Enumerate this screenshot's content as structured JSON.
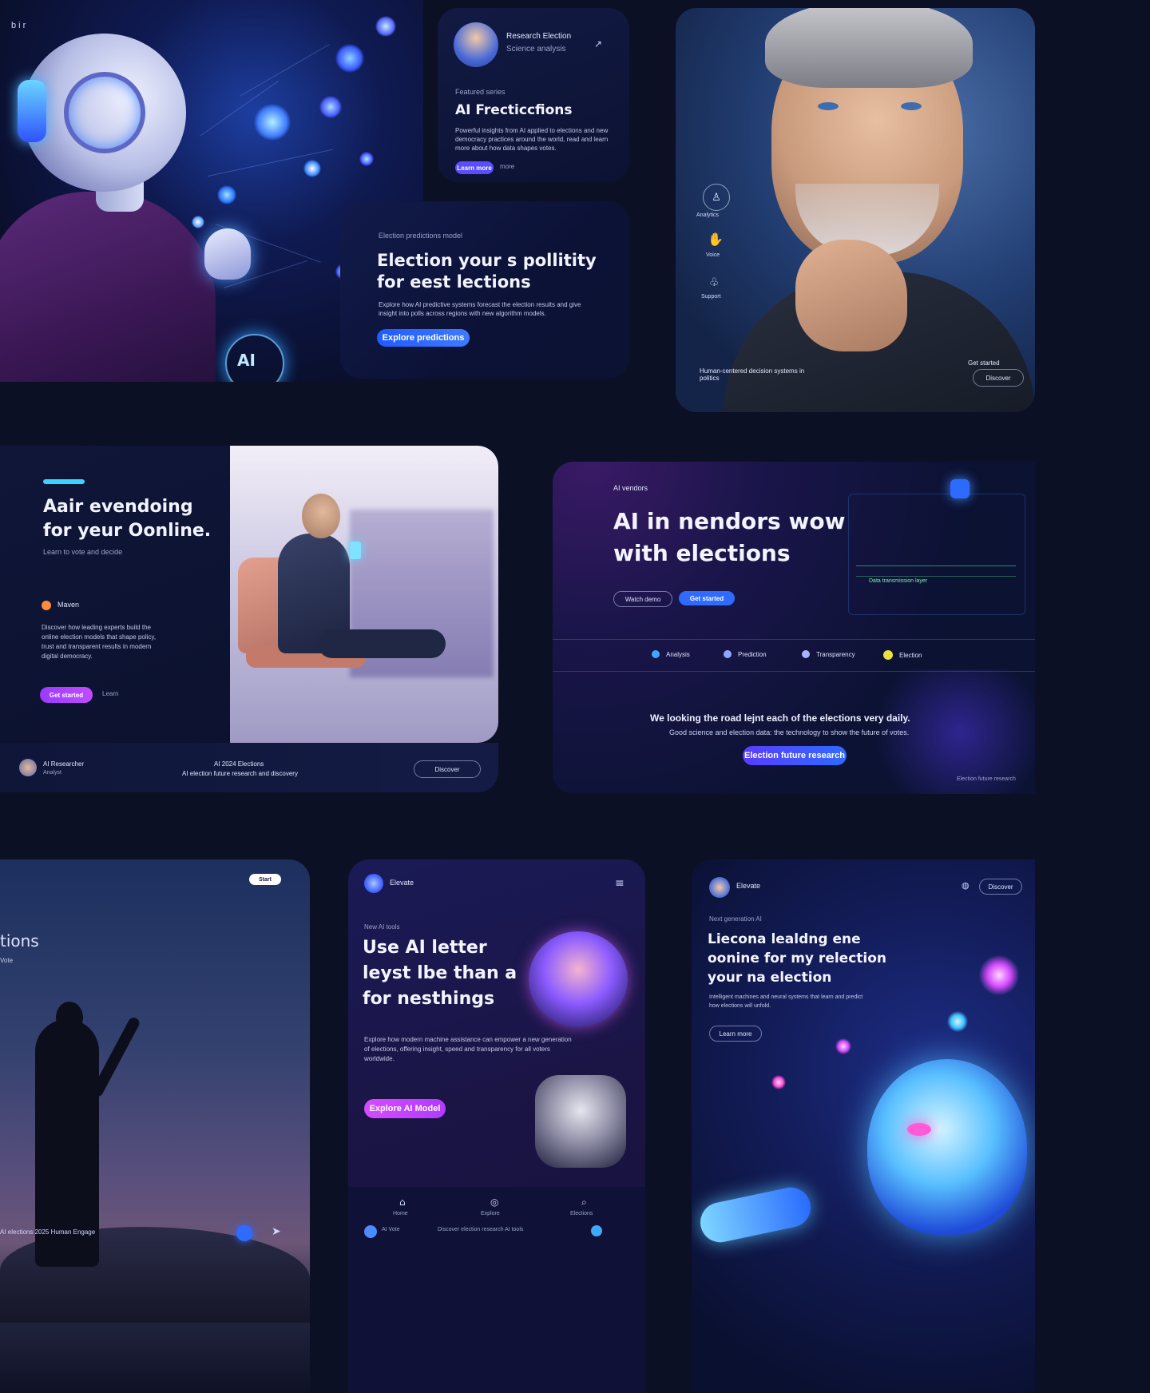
{
  "card1": {
    "top_label": "b i r",
    "badge": "AI"
  },
  "card2": {
    "profile_name": "Research Election",
    "profile_sub": "Science analysis",
    "eyebrow": "Featured series",
    "title": "AI Frecticcfions",
    "body": "Powerful insights from AI applied to elections and new democracy practices around the world, read and learn more about how data shapes votes.",
    "button_label": "Learn more",
    "link_label": "more"
  },
  "card3": {
    "eyebrow": "Election predictions model",
    "title_line1": "Election your s pollitity",
    "title_line2": "for eest lections",
    "body": "Explore how AI predictive systems forecast the election results and give insight into polls across regions with new algorithm models.",
    "button_label": "Explore predictions"
  },
  "card4": {
    "side_icons": [
      "Analytics",
      "Voice",
      "Support"
    ],
    "caption": "Human-centered decision systems in politics",
    "button_label": "Discover",
    "pre_button": "Get started"
  },
  "card5": {
    "title_line1": "Aair evendoing",
    "title_line2": "for yeur Oonline.",
    "subtitle": "Learn to vote and decide",
    "author": "Maven",
    "body": "Discover how leading experts build the online election models that shape policy, trust and transparent results in modern digital democracy.",
    "primary_label": "Get started",
    "secondary_label": "Learn"
  },
  "card5_footer": {
    "person_name": "AI Researcher",
    "person_role": "Analyst",
    "center_line1": "AI 2024 Elections",
    "center_line2": "AI election future research and discovery",
    "button_label": "Discover"
  },
  "card6": {
    "eyebrow": "AI vendors",
    "title_line1": "AI in nendors wow",
    "title_line2": "with elections",
    "ghost_label": "Watch demo",
    "primary_label": "Get started",
    "features": [
      "Analysis",
      "Prediction",
      "Transparency",
      "Election"
    ],
    "statement": "We looking the road lejnt each of the elections very daily.",
    "sub_statement": "Good science and election data: the technology to show the future of votes.",
    "cta_label": "Election future research",
    "corner_note": "Election future research",
    "circuit_label": "Data transmission layer"
  },
  "card7": {
    "partial_title": "tions",
    "partial_sub": "Vote",
    "top_pill": "Start",
    "footer_text": "AI elections 2025 Human Engage"
  },
  "card8": {
    "brand": "Elevate",
    "eyebrow": "New AI tools",
    "title_line1": "Use AI letter",
    "title_line2": "leyst lbe than a",
    "title_line3": "for nesthings",
    "body": "Explore how modern machine assistance can empower a new generation of elections, offering insight, speed and transparency for all voters worldwide.",
    "button_label": "Explore AI Model",
    "nav_items": [
      "Home",
      "Explore",
      "Elections"
    ],
    "footer_name": "AI Vote",
    "footer_text": "Discover election research AI tools"
  },
  "card9": {
    "brand": "Elevate",
    "eyebrow": "Next generation AI",
    "top_pill": "Discover",
    "title_line1": "Liecona lealdng ene",
    "title_line2": "oonine for my relection",
    "title_line3": "your na election",
    "body": "Intelligent machines and neural systems that learn and predict how elections will unfold.",
    "ghost_label": "Learn more"
  },
  "colors": {
    "bg": "#0b1024",
    "accent_blue": "#2f6bff",
    "accent_violet": "#7a4bff",
    "accent_pink": "#d64bff"
  }
}
